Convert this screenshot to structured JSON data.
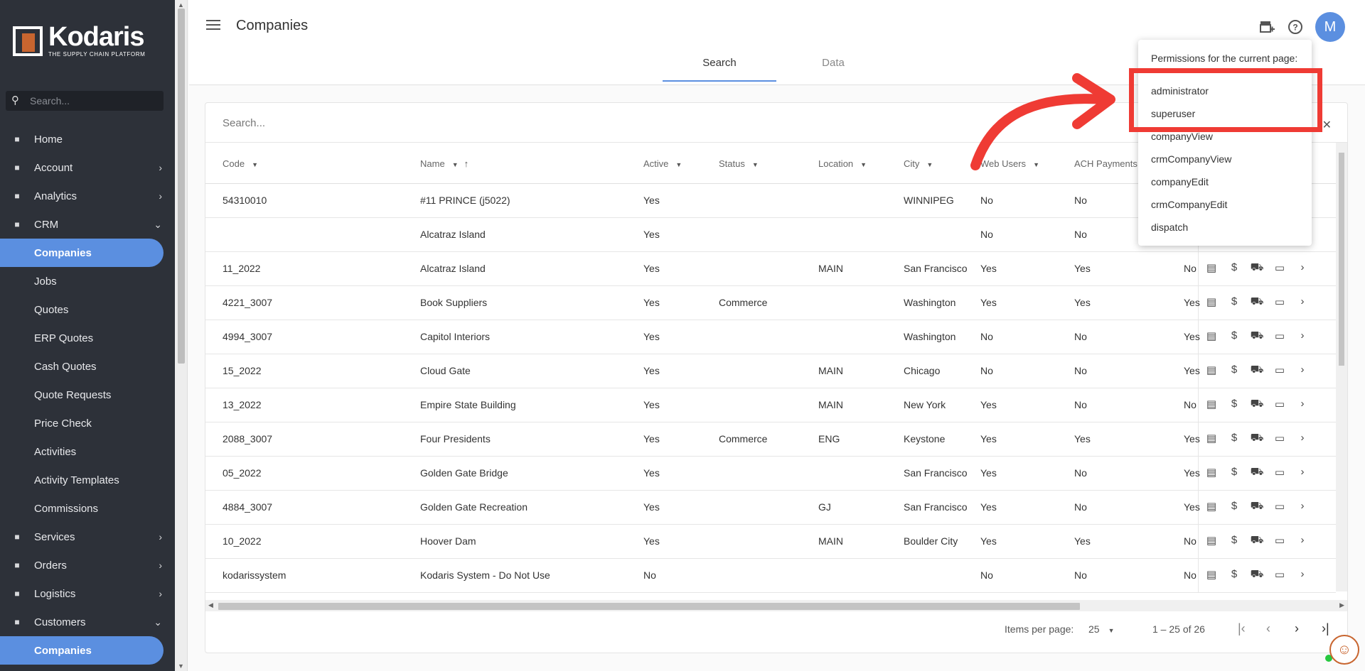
{
  "sidebar": {
    "logo": {
      "name": "Kodaris",
      "tagline": "THE SUPPLY CHAIN PLATFORM"
    },
    "search_placeholder": "Search...",
    "items": [
      {
        "label": "Home",
        "icon": "home-icon",
        "chevron": ""
      },
      {
        "label": "Account",
        "icon": "person-icon",
        "chevron": "›"
      },
      {
        "label": "Analytics",
        "icon": "chart-icon",
        "chevron": "›"
      },
      {
        "label": "CRM",
        "icon": "crm-icon",
        "chevron": "⌄"
      },
      {
        "label": "Companies",
        "sub": true,
        "active": true
      },
      {
        "label": "Jobs",
        "sub": true
      },
      {
        "label": "Quotes",
        "sub": true
      },
      {
        "label": "ERP Quotes",
        "sub": true
      },
      {
        "label": "Cash Quotes",
        "sub": true
      },
      {
        "label": "Quote Requests",
        "sub": true
      },
      {
        "label": "Price Check",
        "sub": true
      },
      {
        "label": "Activities",
        "sub": true
      },
      {
        "label": "Activity Templates",
        "sub": true
      },
      {
        "label": "Commissions",
        "sub": true
      },
      {
        "label": "Services",
        "icon": "services-icon",
        "chevron": "›"
      },
      {
        "label": "Orders",
        "icon": "truck-icon",
        "chevron": "›"
      },
      {
        "label": "Logistics",
        "icon": "logistics-icon",
        "chevron": "›"
      },
      {
        "label": "Customers",
        "icon": "customers-icon",
        "chevron": "⌄"
      },
      {
        "label": "Companies",
        "sub": true,
        "active": true
      }
    ]
  },
  "header": {
    "title": "Companies",
    "avatar_letter": "M",
    "tabs": [
      {
        "label": "Search",
        "active": true
      },
      {
        "label": "Data",
        "active": false
      }
    ]
  },
  "table": {
    "search_placeholder": "Search...",
    "columns": [
      "Code",
      "Name",
      "Active",
      "Status",
      "Location",
      "City",
      "Web Users",
      "ACH Payments"
    ],
    "rows": [
      {
        "code": "54310010",
        "name": "#11 PRINCE (j5022)",
        "active": "Yes",
        "status": "",
        "location": "",
        "city": "WINNIPEG",
        "web": "No",
        "ach": "No",
        "extra": ""
      },
      {
        "code": "",
        "name": "Alcatraz Island",
        "active": "Yes",
        "status": "",
        "location": "",
        "city": "",
        "web": "No",
        "ach": "No",
        "extra": ""
      },
      {
        "code": "11_2022",
        "name": "Alcatraz Island",
        "active": "Yes",
        "status": "",
        "location": "MAIN",
        "city": "San Francisco",
        "web": "Yes",
        "ach": "Yes",
        "extra": "No"
      },
      {
        "code": "4221_3007",
        "name": "Book Suppliers",
        "active": "Yes",
        "status": "Commerce",
        "location": "",
        "city": "Washington",
        "web": "Yes",
        "ach": "Yes",
        "extra": "Yes"
      },
      {
        "code": "4994_3007",
        "name": "Capitol Interiors",
        "active": "Yes",
        "status": "",
        "location": "",
        "city": "Washington",
        "web": "No",
        "ach": "No",
        "extra": "Yes"
      },
      {
        "code": "15_2022",
        "name": "Cloud Gate",
        "active": "Yes",
        "status": "",
        "location": "MAIN",
        "city": "Chicago",
        "web": "No",
        "ach": "No",
        "extra": "Yes"
      },
      {
        "code": "13_2022",
        "name": "Empire State Building",
        "active": "Yes",
        "status": "",
        "location": "MAIN",
        "city": "New York",
        "web": "Yes",
        "ach": "No",
        "extra": "No"
      },
      {
        "code": "2088_3007",
        "name": "Four Presidents",
        "active": "Yes",
        "status": "Commerce",
        "location": "ENG",
        "city": "Keystone",
        "web": "Yes",
        "ach": "Yes",
        "extra": "Yes"
      },
      {
        "code": "05_2022",
        "name": "Golden Gate Bridge",
        "active": "Yes",
        "status": "",
        "location": "",
        "city": "San Francisco",
        "web": "Yes",
        "ach": "No",
        "extra": "Yes"
      },
      {
        "code": "4884_3007",
        "name": "Golden Gate Recreation",
        "active": "Yes",
        "status": "",
        "location": "GJ",
        "city": "San Francisco",
        "web": "Yes",
        "ach": "No",
        "extra": "Yes"
      },
      {
        "code": "10_2022",
        "name": "Hoover Dam",
        "active": "Yes",
        "status": "",
        "location": "MAIN",
        "city": "Boulder City",
        "web": "Yes",
        "ach": "Yes",
        "extra": "No"
      },
      {
        "code": "kodarissystem",
        "name": "Kodaris System - Do Not Use",
        "active": "No",
        "status": "",
        "location": "",
        "city": "",
        "web": "No",
        "ach": "No",
        "extra": "No"
      }
    ]
  },
  "paginator": {
    "items_label": "Items per page:",
    "page_size": "25",
    "range": "1 – 25 of 26"
  },
  "permissions": {
    "header": "Permissions for the current page:",
    "items": [
      "administrator",
      "superuser",
      "companyView",
      "crmCompanyView",
      "companyEdit",
      "crmCompanyEdit",
      "dispatch"
    ]
  },
  "colors": {
    "accent": "#5b8fe0",
    "sidebar_bg": "#2d3139",
    "annotation": "#ef3b34",
    "brand": "#c8652f"
  }
}
